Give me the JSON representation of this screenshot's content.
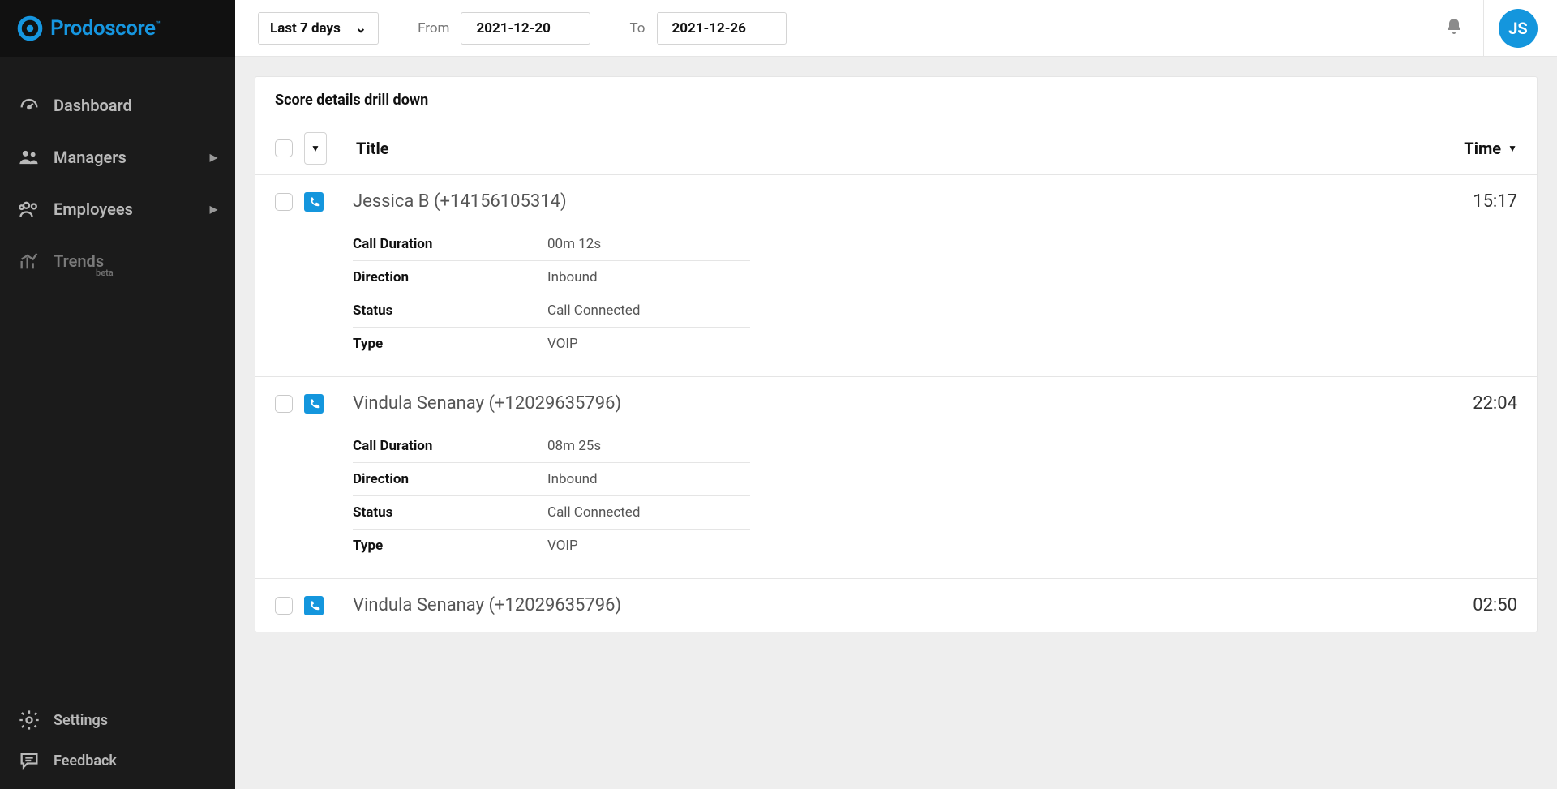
{
  "brand": {
    "name": "Prodoscore",
    "tm": "™"
  },
  "topbar": {
    "range": "Last 7 days",
    "from_label": "From",
    "from_value": "2021-12-20",
    "to_label": "To",
    "to_value": "2021-12-26",
    "avatar_initials": "JS"
  },
  "sidebar": {
    "nav": [
      {
        "label": "Dashboard",
        "icon": "gauge",
        "expandable": false
      },
      {
        "label": "Managers",
        "icon": "people",
        "expandable": true
      },
      {
        "label": "Employees",
        "icon": "group",
        "expandable": true
      },
      {
        "label": "Trends",
        "icon": "chart",
        "expandable": false,
        "beta": "beta",
        "dim": true
      }
    ],
    "bottom": [
      {
        "label": "Settings",
        "icon": "gear"
      },
      {
        "label": "Feedback",
        "icon": "chat"
      }
    ]
  },
  "panel": {
    "title": "Score details drill down",
    "columns": {
      "title": "Title",
      "time": "Time"
    },
    "detail_labels": {
      "duration": "Call Duration",
      "direction": "Direction",
      "status": "Status",
      "type": "Type"
    },
    "rows": [
      {
        "title": "Jessica B (+14156105314)",
        "time": "15:17",
        "expanded": true,
        "details": {
          "duration": "00m 12s",
          "direction": "Inbound",
          "status": "Call Connected",
          "type": "VOIP"
        }
      },
      {
        "title": "Vindula Senanay (+12029635796)",
        "time": "22:04",
        "expanded": true,
        "details": {
          "duration": "08m 25s",
          "direction": "Inbound",
          "status": "Call Connected",
          "type": "VOIP"
        }
      },
      {
        "title": "Vindula Senanay (+12029635796)",
        "time": "02:50",
        "expanded": false
      }
    ]
  }
}
